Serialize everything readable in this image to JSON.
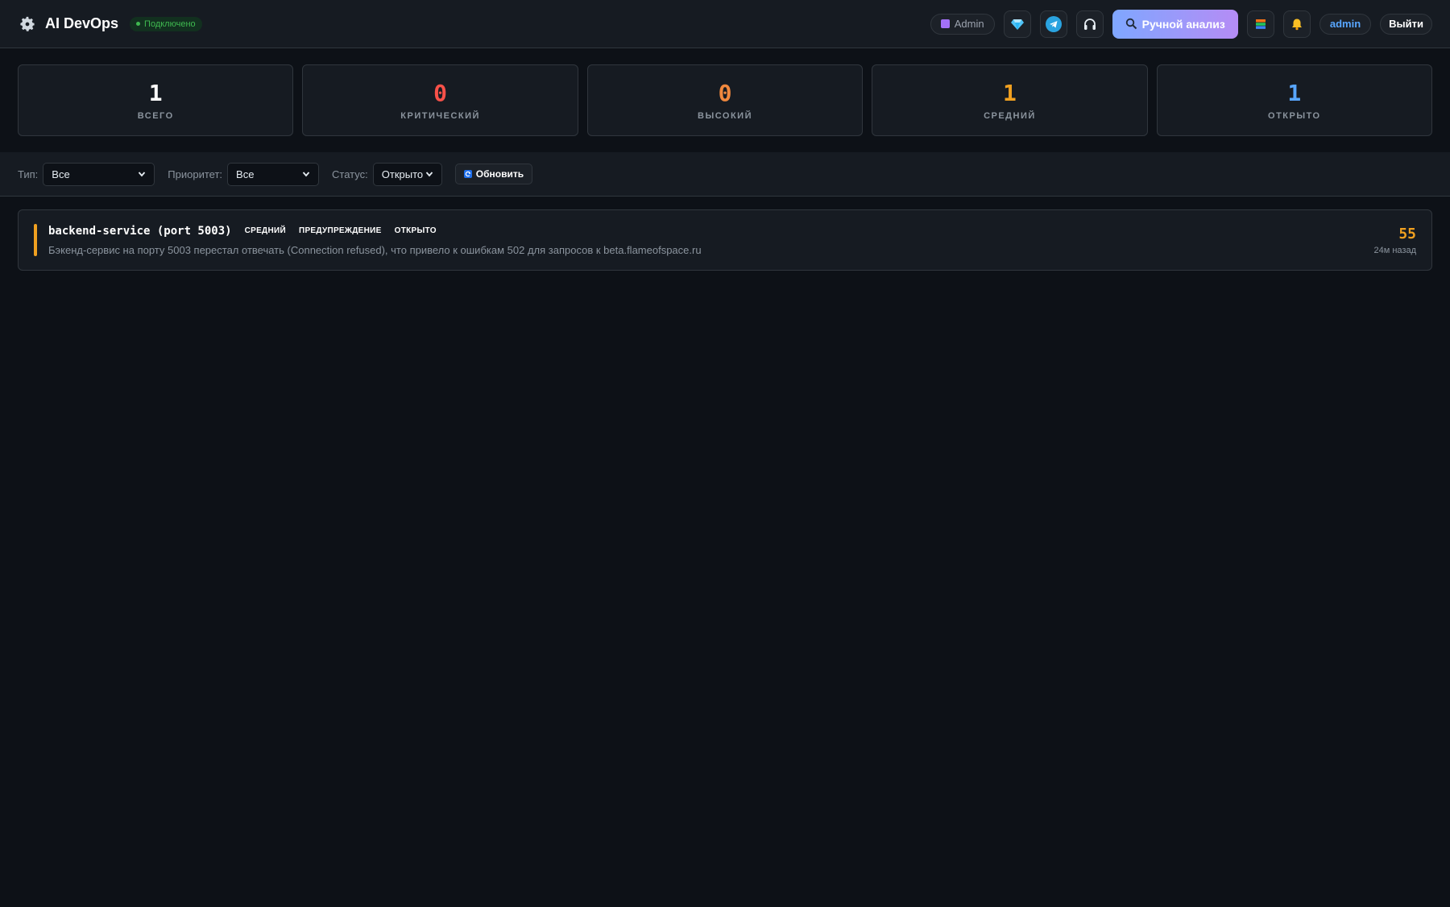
{
  "header": {
    "title": "AI DevOps",
    "connection_status": "Подключено",
    "role_label": "Admin",
    "analyze_label": "Ручной анализ",
    "username": "admin",
    "logout_label": "Выйти",
    "icons": [
      "gear-icon",
      "gem-icon",
      "telegram-icon",
      "headphones-icon",
      "search-icon",
      "books-icon",
      "bell-icon"
    ]
  },
  "stats": [
    {
      "value": "1",
      "label": "ВСЕГО",
      "color": "#ffffff"
    },
    {
      "value": "0",
      "label": "КРИТИЧЕСКИЙ",
      "color": "#f85149"
    },
    {
      "value": "0",
      "label": "ВЫСОКИЙ",
      "color": "#f0883e"
    },
    {
      "value": "1",
      "label": "СРЕДНИЙ",
      "color": "#f0a020"
    },
    {
      "value": "1",
      "label": "ОТКРЫТО",
      "color": "#58a6ff"
    }
  ],
  "filters": {
    "type_label": "Тип:",
    "type_value": "Все",
    "priority_label": "Приоритет:",
    "priority_value": "Все",
    "status_label": "Статус:",
    "status_value": "Открыто",
    "refresh_label": "Обновить"
  },
  "incidents": [
    {
      "title": "backend-service (port 5003)",
      "severity": "СРЕДНИЙ",
      "type": "ПРЕДУПРЕЖДЕНИЕ",
      "status": "ОТКРЫТО",
      "description": "Бэкенд-сервис на порту 5003 перестал отвечать (Connection refused), что привело к ошибкам 502 для запросов к beta.flameofspace.ru",
      "score": "55",
      "time": "24м назад",
      "accent_color": "#f0a020"
    }
  ]
}
